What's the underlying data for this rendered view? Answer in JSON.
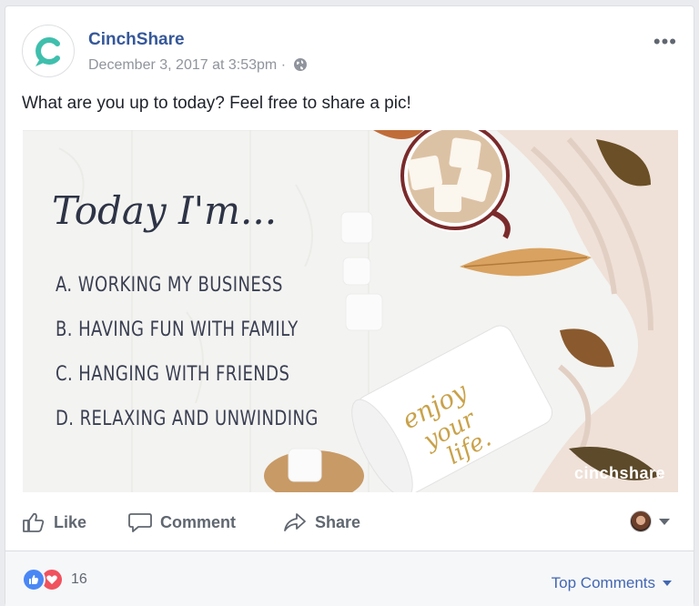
{
  "post": {
    "page_name": "CinchShare",
    "date": "December 3, 2017 at 3:53pm",
    "separator": "·",
    "privacy_icon": "globe-icon",
    "more_icon": "ellipsis-icon",
    "more_label": "•••",
    "text": "What are you up to today? Feel free to share a pic!"
  },
  "image": {
    "title": "Today I'm...",
    "options": [
      "A. WORKING MY BUSINESS",
      "B. HAVING FUN WITH FAMILY",
      "C. HANGING WITH FRIENDS",
      "D. RELAXING AND UNWINDING"
    ],
    "mug_text": "enjoy your life.",
    "watermark": "cinchshare"
  },
  "actions": {
    "like": "Like",
    "comment": "Comment",
    "share": "Share"
  },
  "footer": {
    "reaction_count": "16",
    "top_comments": "Top Comments"
  },
  "colors": {
    "brand_teal": "#3fbfad",
    "link_blue": "#365899",
    "action_grey": "#606770",
    "like_blue": "#4a87f5",
    "love_red": "#f0525e"
  }
}
